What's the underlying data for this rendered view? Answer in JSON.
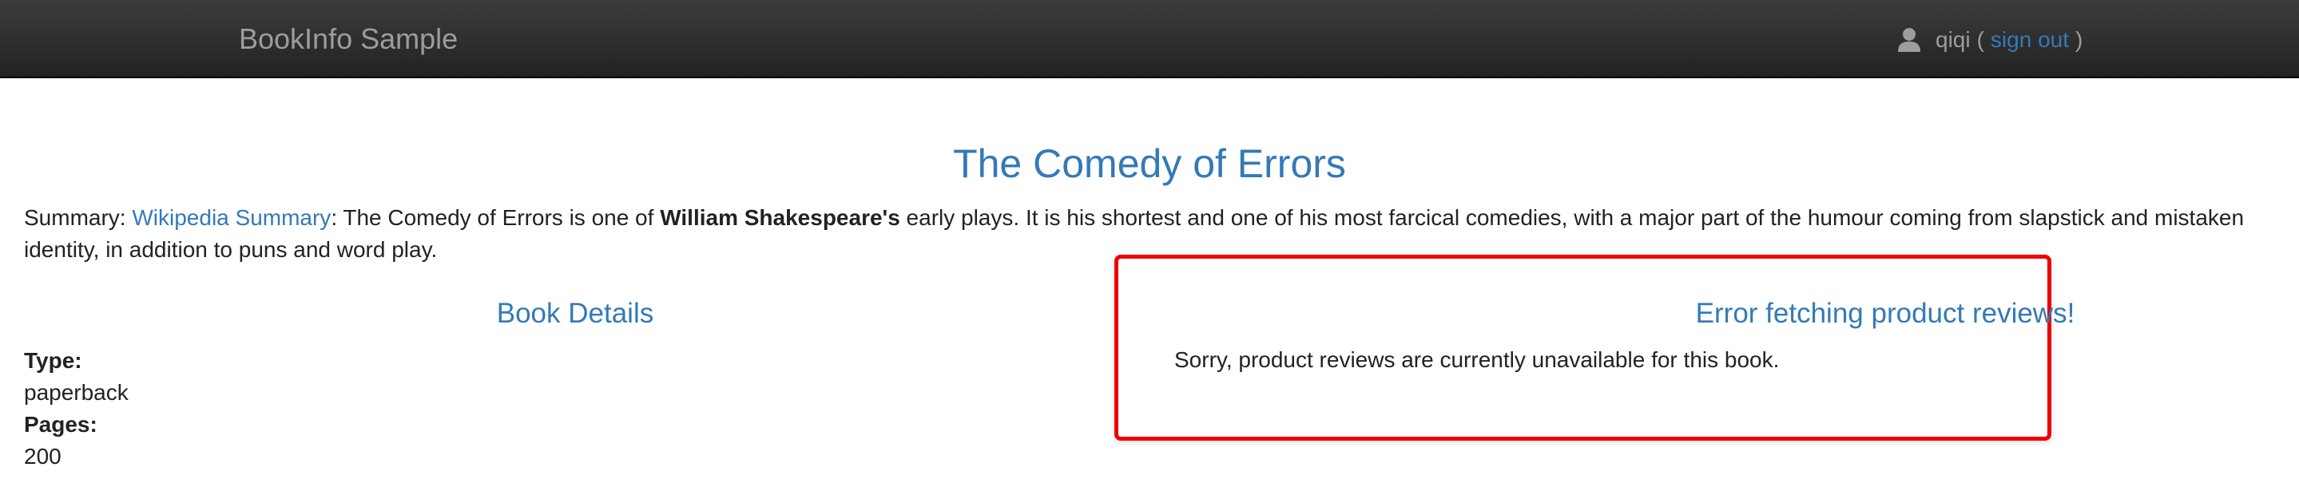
{
  "navbar": {
    "brand": "BookInfo Sample",
    "username": "qiqi",
    "open_paren": "(",
    "signout_label": "sign out",
    "close_paren": ")",
    "user_icon": "user-icon"
  },
  "book": {
    "title": "The Comedy of Errors",
    "summary_prefix": "Summary: ",
    "summary_link": "Wikipedia Summary",
    "summary_text_1": ": The Comedy of Errors is one of ",
    "summary_bold": "William Shakespeare's",
    "summary_text_2": " early plays. It is his shortest and one of his most farcical comedies, with a major part of the humour coming from slapstick and mistaken identity, in addition to puns and word play."
  },
  "details": {
    "heading": "Book Details",
    "type_label": "Type:",
    "type_value": "paperback",
    "pages_label": "Pages:",
    "pages_value": "200"
  },
  "reviews": {
    "heading": "Error fetching product reviews!",
    "message": "Sorry, product reviews are currently unavailable for this book."
  },
  "colors": {
    "link": "#337ab7",
    "navbar": "#222222",
    "error_border": "#ee0000"
  }
}
